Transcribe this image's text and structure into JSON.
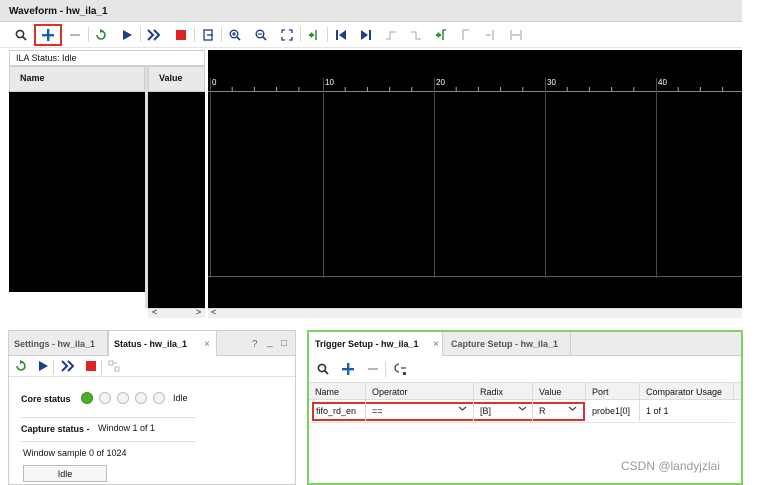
{
  "window": {
    "title": "Waveform - hw_ila_1"
  },
  "toolbar": {
    "icons": [
      "search-icon",
      "add-icon",
      "remove-icon",
      "run-trigger-icon",
      "run-icon",
      "run-immediate-icon",
      "stop-icon",
      "export-icon",
      "zoom-in-icon",
      "zoom-out-icon",
      "zoom-fit-icon",
      "add-marker-icon",
      "go-start-icon",
      "go-end-icon",
      "prev-transition-icon",
      "next-transition-icon",
      "add-cursor-icon",
      "swap-cursor-icon",
      "cursor-icon",
      "range-icon"
    ]
  },
  "ila": {
    "status_label": "ILA Status: Idle",
    "name_header": "Name",
    "value_header": "Value",
    "scroll_left": "<",
    "scroll_right": ">",
    "scroll_left2": "<"
  },
  "waveform": {
    "ticks": [
      "0",
      "10",
      "20",
      "30",
      "40"
    ]
  },
  "settings_panel": {
    "tab1": "Settings - hw_ila_1",
    "tab2": "Status - hw_ila_1",
    "tab2_close": "×",
    "help": "?",
    "minimize": "_",
    "maximize": "□",
    "core_status_label": "Core status",
    "core_status_value": "Idle",
    "capture_status_label": "Capture status -",
    "capture_status_value": "Window 1 of 1",
    "window_sample": "Window sample 0 of 1024",
    "idle_button": "Idle"
  },
  "trigger_panel": {
    "tab1": "Trigger Setup - hw_ila_1",
    "tab1_close": "×",
    "tab2": "Capture Setup - hw_ila_1",
    "columns": [
      "Name",
      "Operator",
      "Radix",
      "Value",
      "Port",
      "Comparator Usage"
    ],
    "row": {
      "name": "fifo_rd_en",
      "operator": "==",
      "radix": "[B]",
      "value": "R",
      "port": "probe1[0]",
      "comparator_usage": "1 of 1"
    }
  },
  "watermark": "CSDN @landyjzlai",
  "colors": {
    "accent_green": "#7dd35f",
    "highlight_red": "#e0302a",
    "status_green": "#4caf2a"
  }
}
